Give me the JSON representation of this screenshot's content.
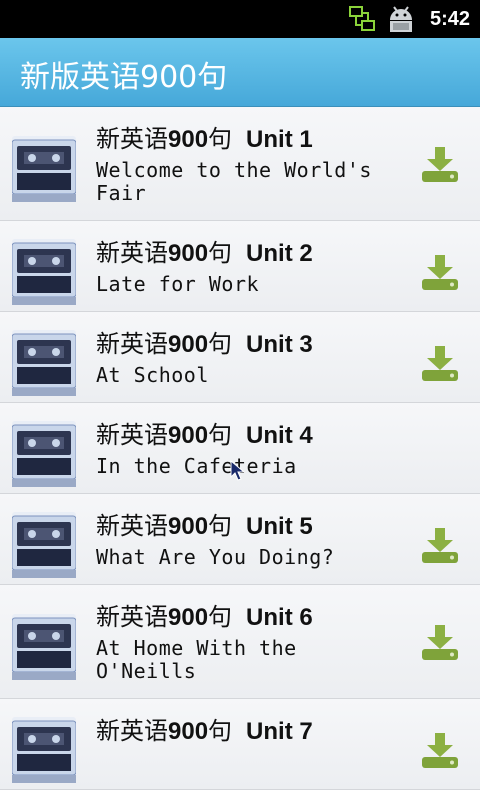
{
  "status": {
    "time": "5:42"
  },
  "app": {
    "title": "新版英语900句"
  },
  "list": {
    "items": [
      {
        "prefix": "新英语",
        "num": "900",
        "suffix": "句",
        "unit": "Unit 1",
        "subtitle": "Welcome to the World's Fair",
        "download": true
      },
      {
        "prefix": "新英语",
        "num": "900",
        "suffix": "句",
        "unit": "Unit 2",
        "subtitle": "Late for Work",
        "download": true
      },
      {
        "prefix": "新英语",
        "num": "900",
        "suffix": "句",
        "unit": "Unit 3",
        "subtitle": "At School",
        "download": true
      },
      {
        "prefix": "新英语",
        "num": "900",
        "suffix": "句",
        "unit": "Unit 4",
        "subtitle": "In the Cafeteria",
        "download": false
      },
      {
        "prefix": "新英语",
        "num": "900",
        "suffix": "句",
        "unit": "Unit 5",
        "subtitle": "What Are You Doing?",
        "download": true
      },
      {
        "prefix": "新英语",
        "num": "900",
        "suffix": "句",
        "unit": "Unit 6",
        "subtitle": "At Home With the O'Neills",
        "download": true
      },
      {
        "prefix": "新英语",
        "num": "900",
        "suffix": "句",
        "unit": "Unit 7",
        "subtitle": "",
        "download": true
      }
    ]
  },
  "colors": {
    "title_bar": "#5bb7e5",
    "download_icon": "#7fa33a"
  }
}
